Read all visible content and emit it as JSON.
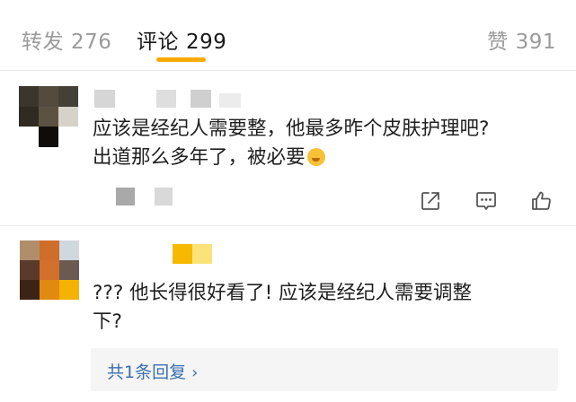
{
  "tabs": {
    "repost": {
      "label": "转发",
      "count": "276"
    },
    "comment": {
      "label": "评论",
      "count": "299"
    },
    "like": {
      "label": "赞",
      "count": "391"
    }
  },
  "comments": [
    {
      "text_line1": "应该是经纪人需要整，他最多昨个皮肤护理吧?",
      "text_line2": "出道那么多年了，被必要"
    },
    {
      "text_line1": "??? 他长得很好看了! 应该是经纪人需要调整",
      "text_line2": "下?",
      "reply_link": "共1条回复"
    }
  ],
  "icons": [
    "share-icon",
    "comment-icon",
    "like-icon",
    "chevron-right-icon"
  ],
  "colors": {
    "accent": "#f7ab00",
    "link": "#3a6fb0",
    "muted": "#9b9b9b"
  }
}
